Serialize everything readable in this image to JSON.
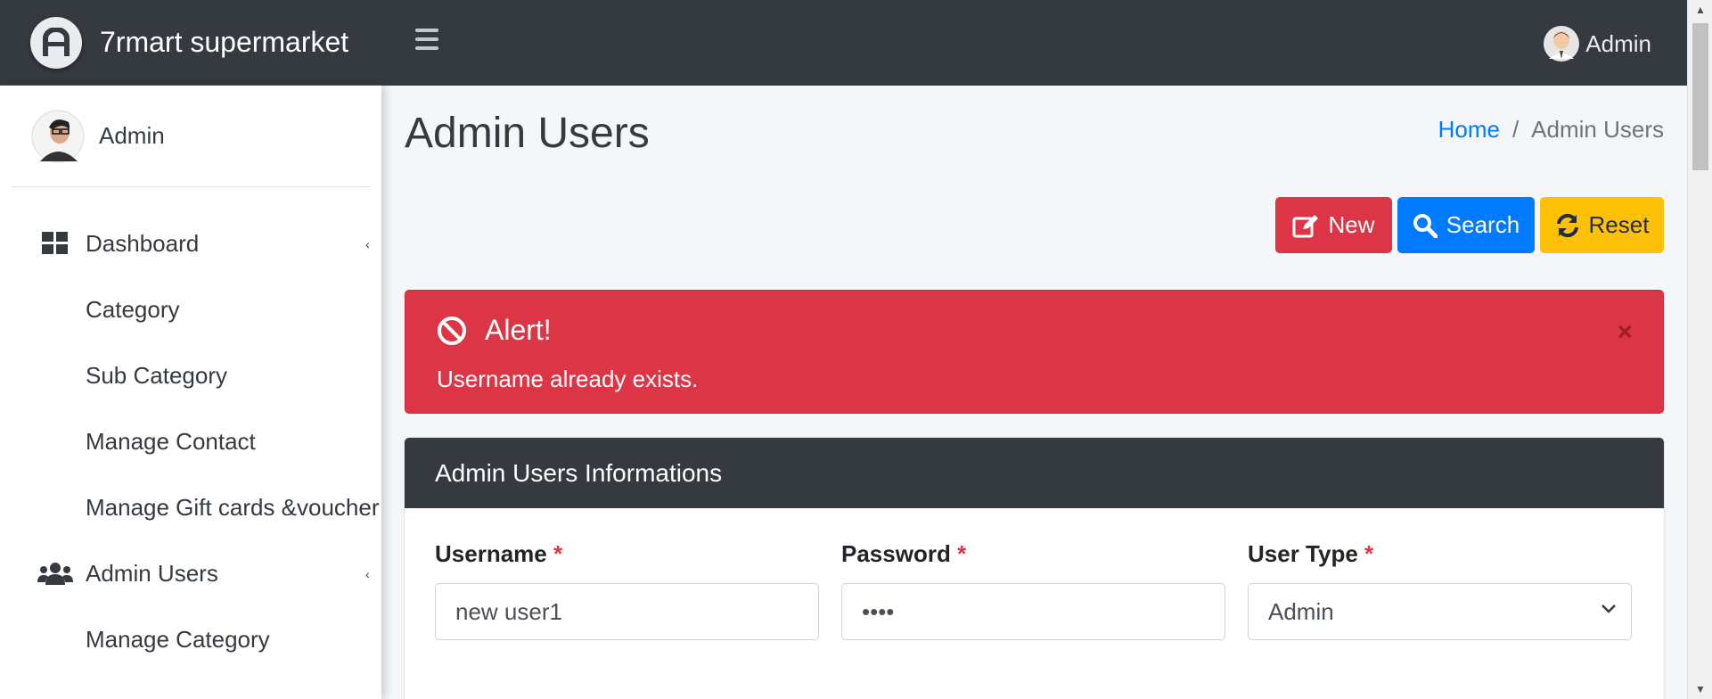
{
  "brand": {
    "name": "7rmart supermarket",
    "logo_icon": "a-logo-icon"
  },
  "topbar": {
    "user_name": "Admin"
  },
  "sidebar": {
    "user_name": "Admin",
    "items": [
      {
        "label": "Dashboard",
        "icon": "dashboard-icon",
        "has_caret": true
      },
      {
        "label": "Category"
      },
      {
        "label": "Sub Category"
      },
      {
        "label": "Manage Contact"
      },
      {
        "label": "Manage Gift cards &voucher"
      },
      {
        "label": "Admin Users",
        "icon": "users-icon",
        "has_caret": true
      },
      {
        "label": "Manage Category"
      }
    ]
  },
  "page": {
    "title": "Admin Users",
    "breadcrumb": {
      "home": "Home",
      "separator": "/",
      "current": "Admin Users"
    }
  },
  "actions": {
    "new": "New",
    "search": "Search",
    "reset": "Reset"
  },
  "alert": {
    "title": "Alert!",
    "message": "Username already exists.",
    "close": "×"
  },
  "form": {
    "header": "Admin Users Informations",
    "username": {
      "label": "Username",
      "required": "*",
      "value": "new user1"
    },
    "password": {
      "label": "Password",
      "required": "*",
      "value": "••••"
    },
    "user_type": {
      "label": "User Type",
      "required": "*",
      "value": "Admin"
    }
  },
  "colors": {
    "navbar": "#343a40",
    "danger": "#dc3545",
    "primary": "#007bff",
    "warning": "#ffc107",
    "content_bg": "#f4f6f9"
  }
}
